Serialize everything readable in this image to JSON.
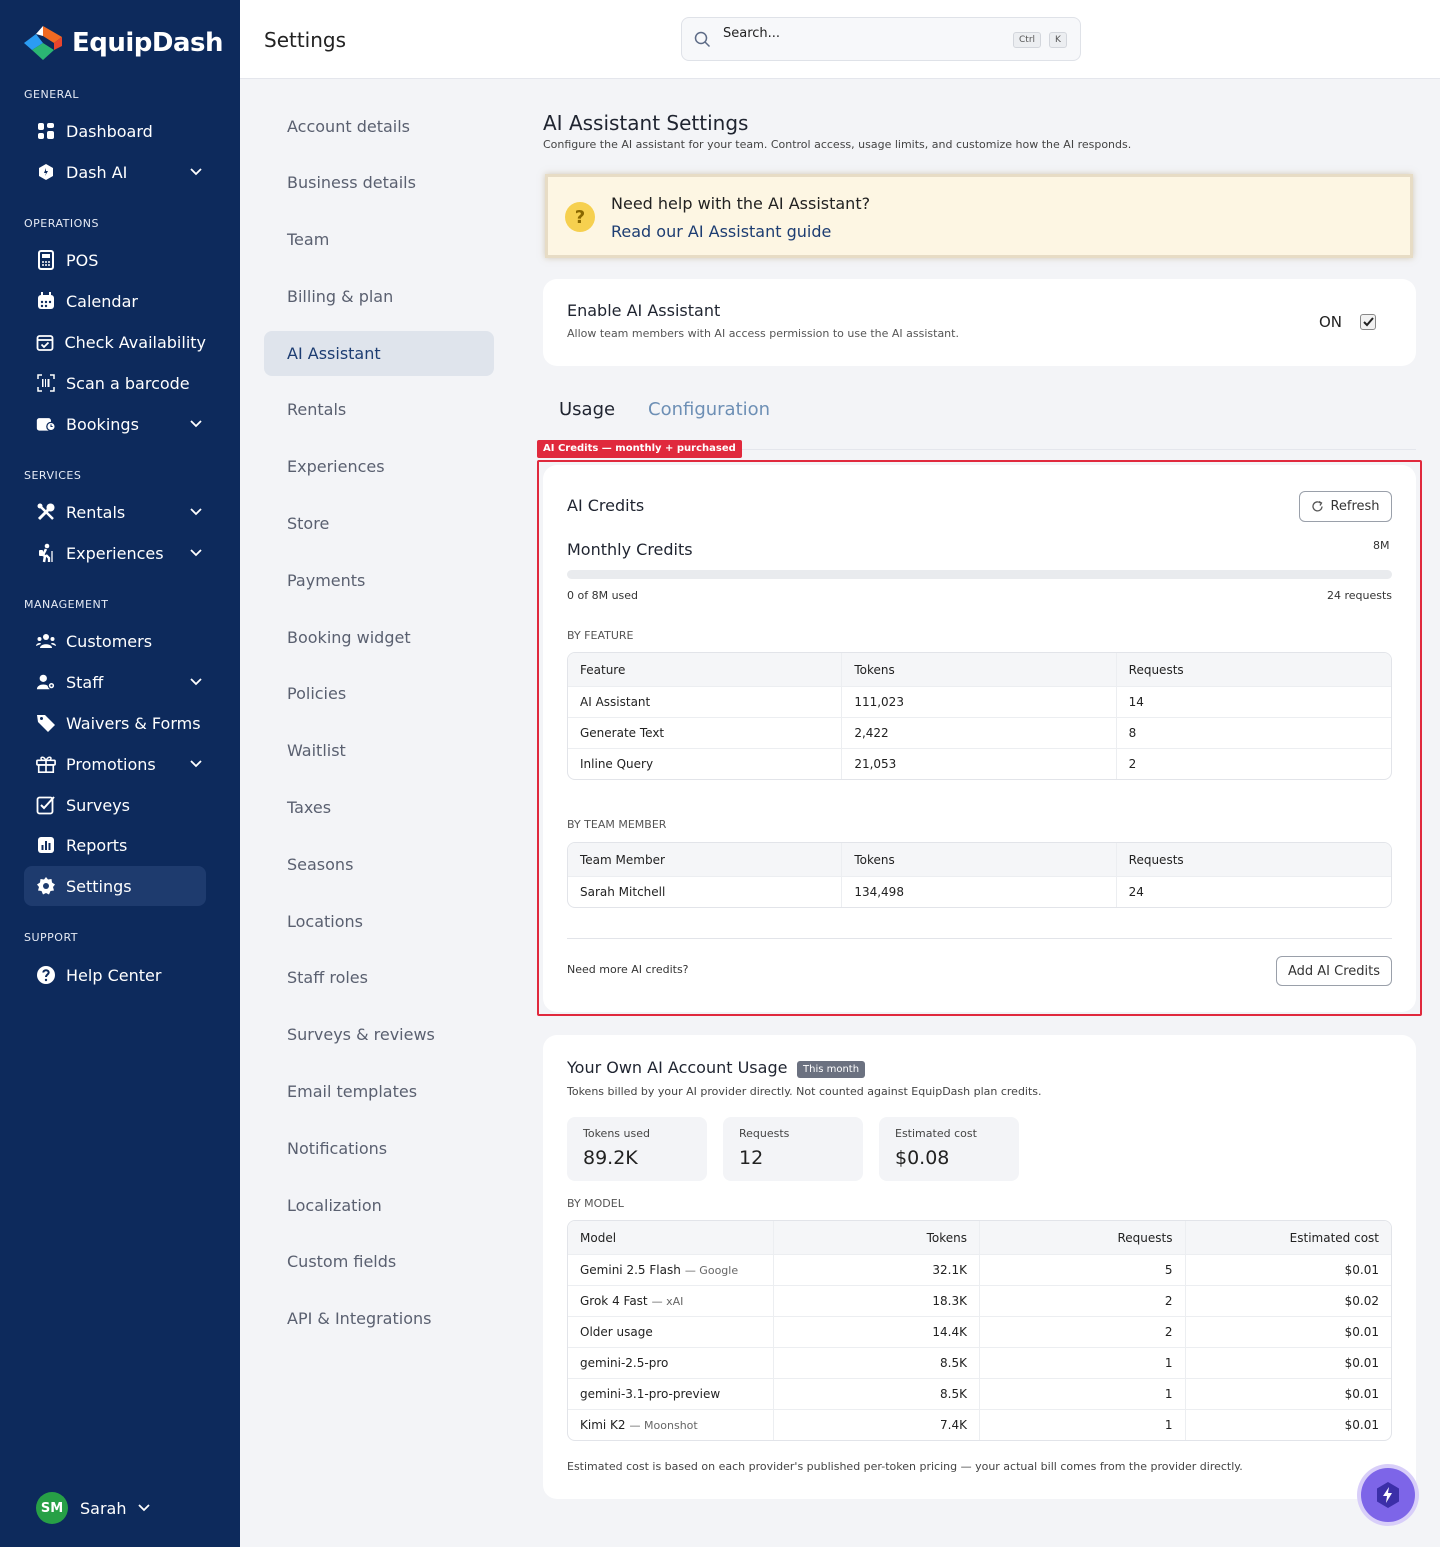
{
  "brand": {
    "name": "EquipDash"
  },
  "sidebar": {
    "sections": [
      {
        "label": "GENERAL"
      },
      {
        "label": "OPERATIONS"
      },
      {
        "label": "SERVICES"
      },
      {
        "label": "MANAGEMENT"
      },
      {
        "label": "SUPPORT"
      }
    ],
    "items": [
      {
        "label": "Dashboard"
      },
      {
        "label": "Dash AI"
      },
      {
        "label": "POS"
      },
      {
        "label": "Calendar"
      },
      {
        "label": "Check Availability"
      },
      {
        "label": "Scan a barcode"
      },
      {
        "label": "Bookings"
      },
      {
        "label": "Rentals"
      },
      {
        "label": "Experiences"
      },
      {
        "label": "Customers"
      },
      {
        "label": "Staff"
      },
      {
        "label": "Waivers & Forms"
      },
      {
        "label": "Promotions"
      },
      {
        "label": "Surveys"
      },
      {
        "label": "Reports"
      },
      {
        "label": "Settings"
      },
      {
        "label": "Help Center"
      }
    ],
    "user": {
      "initials": "SM",
      "name": "Sarah"
    }
  },
  "header": {
    "title": "Settings",
    "search_placeholder": "Search...",
    "shortcut_ctrl": "Ctrl",
    "shortcut_key": "K"
  },
  "settings_nav": [
    "Account details",
    "Business details",
    "Team",
    "Billing & plan",
    "AI Assistant",
    "Rentals",
    "Experiences",
    "Store",
    "Payments",
    "Booking widget",
    "Policies",
    "Waitlist",
    "Taxes",
    "Seasons",
    "Locations",
    "Staff roles",
    "Surveys & reviews",
    "Email templates",
    "Notifications",
    "Localization",
    "Custom fields",
    "API & Integrations"
  ],
  "main": {
    "title": "AI Assistant Settings",
    "subtitle": "Configure the AI assistant for your team. Control access, usage limits, and customize how the AI responds.",
    "help": {
      "question": "Need help with the AI Assistant?",
      "link": "Read our AI Assistant guide"
    },
    "enable": {
      "title": "Enable AI Assistant",
      "desc": "Allow team members with AI access permission to use the AI assistant.",
      "state": "ON"
    },
    "tabs": {
      "usage": "Usage",
      "configuration": "Configuration"
    },
    "annotation_label": "AI Credits — monthly + purchased",
    "credits": {
      "title": "AI Credits",
      "refresh": "Refresh",
      "monthly_title": "Monthly Credits",
      "monthly_total": "8M",
      "used_fraction": 0,
      "used_text": "0 of 8M used",
      "requests_text": "24 requests",
      "by_feature_label": "BY FEATURE",
      "feature_headers": [
        "Feature",
        "Tokens",
        "Requests"
      ],
      "feature_rows": [
        [
          "AI Assistant",
          "111,023",
          "14"
        ],
        [
          "Generate Text",
          "2,422",
          "8"
        ],
        [
          "Inline Query",
          "21,053",
          "2"
        ]
      ],
      "by_member_label": "BY TEAM MEMBER",
      "member_headers": [
        "Team Member",
        "Tokens",
        "Requests"
      ],
      "member_rows": [
        [
          "Sarah Mitchell",
          "134,498",
          "24"
        ]
      ],
      "more_text": "Need more AI credits?",
      "add_button": "Add AI Credits"
    },
    "own": {
      "title": "Your Own AI Account Usage",
      "badge": "This month",
      "desc": "Tokens billed by your AI provider directly. Not counted against EquipDash plan credits.",
      "stats": [
        {
          "label": "Tokens used",
          "value": "89.2K"
        },
        {
          "label": "Requests",
          "value": "12"
        },
        {
          "label": "Estimated cost",
          "value": "$0.08"
        }
      ],
      "by_model_label": "BY MODEL",
      "model_headers": [
        "Model",
        "Tokens",
        "Requests",
        "Estimated cost"
      ],
      "model_rows": [
        {
          "model": "Gemini 2.5 Flash",
          "provider": "— Google",
          "tokens": "32.1K",
          "requests": "5",
          "cost": "$0.01"
        },
        {
          "model": "Grok 4 Fast",
          "provider": "— xAI",
          "tokens": "18.3K",
          "requests": "2",
          "cost": "$0.02"
        },
        {
          "model": "Older usage",
          "provider": "",
          "tokens": "14.4K",
          "requests": "2",
          "cost": "$0.01"
        },
        {
          "model": "gemini-2.5-pro",
          "provider": "",
          "tokens": "8.5K",
          "requests": "1",
          "cost": "$0.01"
        },
        {
          "model": "gemini-3.1-pro-preview",
          "provider": "",
          "tokens": "8.5K",
          "requests": "1",
          "cost": "$0.01"
        },
        {
          "model": "Kimi K2",
          "provider": "— Moonshot",
          "tokens": "7.4K",
          "requests": "1",
          "cost": "$0.01"
        }
      ],
      "footnote": "Estimated cost is based on each provider's published per-token pricing — your actual bill comes from the provider directly."
    }
  },
  "colors": {
    "sidebar": "#0d2a5c",
    "accent": "#1d3d72",
    "annotation": "#e0293d",
    "fab": "#7d65e8"
  }
}
